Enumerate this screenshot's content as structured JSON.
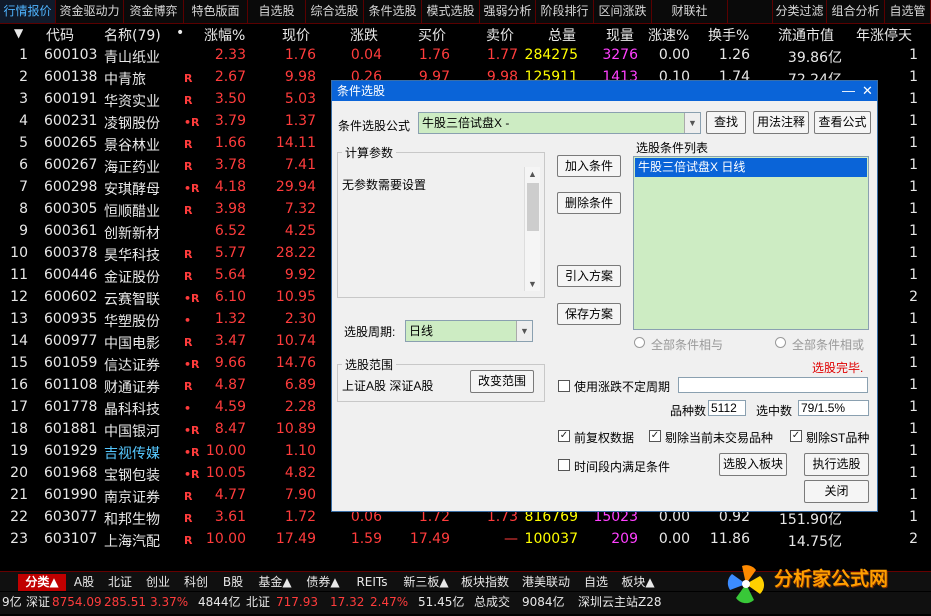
{
  "top_tabs": [
    "行情报价",
    "资金驱动力",
    "资金博弈",
    "特色版面",
    "自选股",
    "综合选股",
    "条件选股",
    "模式选股",
    "强弱分析",
    "阶段排行",
    "区间涨跌",
    "财联社",
    "",
    "分类过滤",
    "组合分析",
    "自选管"
  ],
  "columns": {
    "idx": "▼",
    "code": "代码",
    "name": "名称(79)",
    "dot": "•",
    "pct": "涨幅%",
    "price": "现价",
    "chg": "涨跌",
    "bid": "买价",
    "ask": "卖价",
    "vol": "总量",
    "cur": "现量",
    "speed": "涨速%",
    "turn": "换手%",
    "mcap": "流通市值",
    "ylimit": "年涨停天"
  },
  "rows": [
    {
      "i": "1",
      "code": "600103",
      "name": "青山纸业",
      "mark": "",
      "pct": "2.33",
      "price": "1.76",
      "chg": "0.04",
      "bid": "1.76",
      "ask": "1.77",
      "vol": "284275",
      "cur": "3276",
      "speed": "0.00",
      "turn": "1.26",
      "mcap": "39.86亿",
      "yl": "1"
    },
    {
      "i": "2",
      "code": "600138",
      "name": "中青旅",
      "mark": "R",
      "pct": "2.67",
      "price": "9.98",
      "chg": "0.26",
      "bid": "9.97",
      "ask": "9.98",
      "vol": "125911",
      "cur": "1413",
      "speed": "0.10",
      "turn": "1.74",
      "mcap": "72.24亿",
      "yl": "1"
    },
    {
      "i": "3",
      "code": "600191",
      "name": "华资实业",
      "mark": "R",
      "pct": "3.50",
      "price": "5.03",
      "chg": "",
      "bid": "",
      "ask": "",
      "vol": "",
      "cur": "",
      "speed": "",
      "turn": "",
      "mcap": "",
      "yl": "1"
    },
    {
      "i": "4",
      "code": "600231",
      "name": "凌钢股份",
      "mark": "•R",
      "pct": "3.79",
      "price": "1.37",
      "chg": "",
      "bid": "",
      "ask": "",
      "vol": "",
      "cur": "",
      "speed": "",
      "turn": "",
      "mcap": "",
      "yl": "1"
    },
    {
      "i": "5",
      "code": "600265",
      "name": "景谷林业",
      "mark": "R",
      "pct": "1.66",
      "price": "14.11",
      "chg": "",
      "bid": "",
      "ask": "",
      "vol": "",
      "cur": "",
      "speed": "",
      "turn": "",
      "mcap": "",
      "yl": "1"
    },
    {
      "i": "6",
      "code": "600267",
      "name": "海正药业",
      "mark": "R",
      "pct": "3.78",
      "price": "7.41",
      "chg": "",
      "bid": "",
      "ask": "",
      "vol": "",
      "cur": "",
      "speed": "",
      "turn": "",
      "mcap": "",
      "yl": "1"
    },
    {
      "i": "7",
      "code": "600298",
      "name": "安琪酵母",
      "mark": "•R",
      "pct": "4.18",
      "price": "29.94",
      "chg": "",
      "bid": "",
      "ask": "",
      "vol": "",
      "cur": "",
      "speed": "",
      "turn": "",
      "mcap": "",
      "yl": "1"
    },
    {
      "i": "8",
      "code": "600305",
      "name": "恒顺醋业",
      "mark": "R",
      "pct": "3.98",
      "price": "7.32",
      "chg": "",
      "bid": "",
      "ask": "",
      "vol": "",
      "cur": "",
      "speed": "",
      "turn": "",
      "mcap": "",
      "yl": "1"
    },
    {
      "i": "9",
      "code": "600361",
      "name": "创新新材",
      "mark": "",
      "pct": "6.52",
      "price": "4.25",
      "chg": "",
      "bid": "",
      "ask": "",
      "vol": "",
      "cur": "",
      "speed": "",
      "turn": "",
      "mcap": "",
      "yl": "1"
    },
    {
      "i": "10",
      "code": "600378",
      "name": "昊华科技",
      "mark": "R",
      "pct": "5.77",
      "price": "28.22",
      "chg": "",
      "bid": "",
      "ask": "",
      "vol": "",
      "cur": "",
      "speed": "",
      "turn": "",
      "mcap": "",
      "yl": "1"
    },
    {
      "i": "11",
      "code": "600446",
      "name": "金证股份",
      "mark": "R",
      "pct": "5.64",
      "price": "9.92",
      "chg": "",
      "bid": "",
      "ask": "",
      "vol": "",
      "cur": "",
      "speed": "",
      "turn": "",
      "mcap": "",
      "yl": "1"
    },
    {
      "i": "12",
      "code": "600602",
      "name": "云赛智联",
      "mark": "•R",
      "pct": "6.10",
      "price": "10.95",
      "chg": "",
      "bid": "",
      "ask": "",
      "vol": "",
      "cur": "",
      "speed": "",
      "turn": "",
      "mcap": "",
      "yl": "2"
    },
    {
      "i": "13",
      "code": "600935",
      "name": "华塑股份",
      "mark": "•",
      "pct": "1.32",
      "price": "2.30",
      "chg": "",
      "bid": "",
      "ask": "",
      "vol": "",
      "cur": "",
      "speed": "",
      "turn": "",
      "mcap": "",
      "yl": "1"
    },
    {
      "i": "14",
      "code": "600977",
      "name": "中国电影",
      "mark": "R",
      "pct": "3.47",
      "price": "10.74",
      "chg": "",
      "bid": "",
      "ask": "",
      "vol": "",
      "cur": "",
      "speed": "",
      "turn": "",
      "mcap": "",
      "yl": "1"
    },
    {
      "i": "15",
      "code": "601059",
      "name": "信达证券",
      "mark": "•R",
      "pct": "9.66",
      "price": "14.76",
      "chg": "",
      "bid": "",
      "ask": "",
      "vol": "",
      "cur": "",
      "speed": "",
      "turn": "",
      "mcap": "",
      "yl": "1"
    },
    {
      "i": "16",
      "code": "601108",
      "name": "财通证券",
      "mark": "R",
      "pct": "4.87",
      "price": "6.89",
      "chg": "",
      "bid": "",
      "ask": "",
      "vol": "",
      "cur": "",
      "speed": "",
      "turn": "",
      "mcap": "",
      "yl": "1"
    },
    {
      "i": "17",
      "code": "601778",
      "name": "晶科科技",
      "mark": "•",
      "pct": "4.59",
      "price": "2.28",
      "chg": "",
      "bid": "",
      "ask": "",
      "vol": "",
      "cur": "",
      "speed": "",
      "turn": "",
      "mcap": "",
      "yl": "1"
    },
    {
      "i": "18",
      "code": "601881",
      "name": "中国银河",
      "mark": "•R",
      "pct": "8.47",
      "price": "10.89",
      "chg": "",
      "bid": "",
      "ask": "",
      "vol": "",
      "cur": "",
      "speed": "",
      "turn": "",
      "mcap": "",
      "yl": "1"
    },
    {
      "i": "19",
      "code": "601929",
      "name": "吉视传媒",
      "mark": "•R",
      "pct": "10.00",
      "price": "1.10",
      "chg": "",
      "bid": "",
      "ask": "",
      "vol": "",
      "cur": "",
      "speed": "",
      "turn": "",
      "mcap": "",
      "yl": "1",
      "cyan": true
    },
    {
      "i": "20",
      "code": "601968",
      "name": "宝钢包装",
      "mark": "•R",
      "pct": "10.05",
      "price": "4.82",
      "chg": "",
      "bid": "",
      "ask": "",
      "vol": "",
      "cur": "",
      "speed": "",
      "turn": "",
      "mcap": "",
      "yl": "1"
    },
    {
      "i": "21",
      "code": "601990",
      "name": "南京证券",
      "mark": "R",
      "pct": "4.77",
      "price": "7.90",
      "chg": "",
      "bid": "",
      "ask": "",
      "vol": "",
      "cur": "",
      "speed": "",
      "turn": "",
      "mcap": "",
      "yl": "1"
    },
    {
      "i": "22",
      "code": "603077",
      "name": "和邦生物",
      "mark": "R",
      "pct": "3.61",
      "price": "1.72",
      "chg": "0.06",
      "bid": "1.72",
      "ask": "1.73",
      "vol": "816769",
      "cur": "15023",
      "speed": "0.00",
      "turn": "0.92",
      "mcap": "151.90亿",
      "yl": "1"
    },
    {
      "i": "23",
      "code": "603107",
      "name": "上海汽配",
      "mark": "R",
      "pct": "10.00",
      "price": "17.49",
      "chg": "1.59",
      "bid": "17.49",
      "ask": "—",
      "vol": "100037",
      "cur": "209",
      "speed": "0.00",
      "turn": "11.86",
      "mcap": "14.75亿",
      "yl": "2"
    }
  ],
  "bottom_tabs": [
    "分类▲",
    "A股",
    "北证",
    "创业",
    "科创",
    "B股",
    "基金▲",
    "债券▲",
    "REITs",
    "新三板▲",
    "板块指数",
    "港美联动",
    "自选",
    "板块▲"
  ],
  "status": {
    "s1": "9亿",
    "s2": "深证",
    "s3": "8754.09",
    "s4": "285.51",
    "s5": "3.37%",
    "s6": "4844亿",
    "s7": "北证",
    "s8": "717.93",
    "s9": "17.32",
    "s10": "2.47%",
    "s11": "51.45亿",
    "s12": "总成交",
    "s13": "9084亿",
    "s14": "深圳云主站Z28"
  },
  "logo": {
    "text": "分析家公式网"
  },
  "dialog": {
    "title": "条件选股",
    "formula_label": "条件选股公式",
    "formula_value": "牛股三倍试盘X  -",
    "find_btn": "查找",
    "usage_btn": "用法注释",
    "view_btn": "查看公式",
    "params_title": "计算参数",
    "params_text": "无参数需要设置",
    "add_btn": "加入条件",
    "del_btn": "删除条件",
    "import_btn": "引入方案",
    "save_btn": "保存方案",
    "cond_list_title": "选股条件列表",
    "cond_item": "牛股三倍试盘X  日线",
    "radio_and": "全部条件相与",
    "radio_or": "全部条件相或",
    "status_done": "选股完毕.",
    "period_label": "选股周期:",
    "period_value": "日线",
    "range_title": "选股范围",
    "range_text": "上证A股 深证A股",
    "change_range_btn": "改变范围",
    "variable_period_label": "使用涨跌不定周期",
    "count_label": "品种数",
    "count_value": "5112",
    "selected_label": "选中数",
    "selected_value": "79/1.5%",
    "fq_label": "前复权数据",
    "exclude_untraded_label": "剔除当前未交易品种",
    "exclude_st_label": "剔除ST品种",
    "time_range_label": "时间段内满足条件",
    "to_block_btn": "选股入板块",
    "exec_btn": "执行选股",
    "close_btn": "关闭",
    "colors": {
      "title_bar": "#0a64d8",
      "list_bg": "#cdecc3",
      "selected": "#0a64d8",
      "status_red": "#e00000"
    }
  },
  "colors": {
    "up": "#ff3c3c",
    "code": "#e8e8e8",
    "bg": "#000000",
    "vol": "#ffff00",
    "cur": "#ff40ff"
  }
}
